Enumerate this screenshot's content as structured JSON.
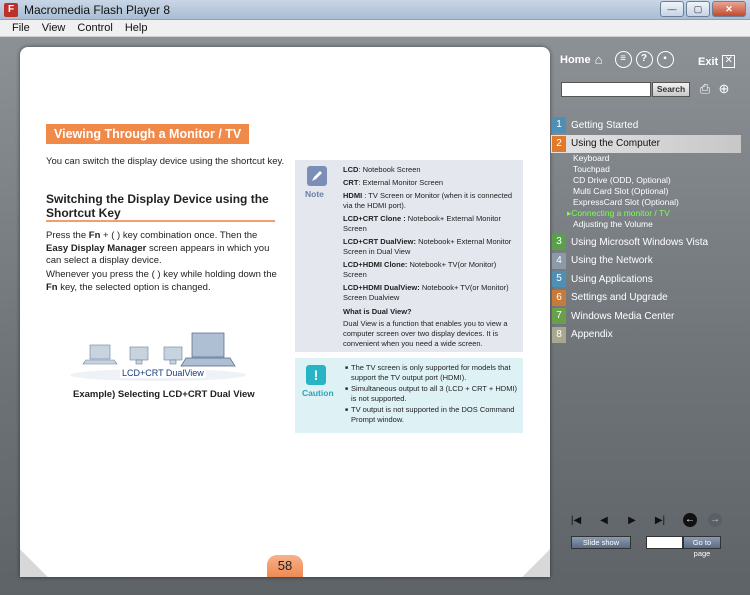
{
  "window": {
    "title": "Macromedia Flash Player 8",
    "app_icon": "F",
    "minimize": "—",
    "maximize": "▢",
    "close": "✕"
  },
  "menu": [
    "File",
    "View",
    "Control",
    "Help"
  ],
  "header": {
    "home_label": "Home",
    "exit_label": "Exit",
    "search_placeholder": "",
    "search_label": "Search"
  },
  "page": {
    "heading": "Viewing Through a Monitor / TV",
    "intro": "You can switch the display device using the shortcut key.",
    "section_title": "Switching the Display Device using the Shortcut Key",
    "para1_a": "Press the ",
    "para1_b": "Fn",
    "para1_c": " + (   ) key combination once. Then the ",
    "para1_d": "Easy Display Manager",
    "para1_e": " screen appears in which you can select a display device.",
    "para2_a": "Whenever you press the (   ) key while holding down the ",
    "para2_b": "Fn",
    "para2_c": " key, the selected option is changed.",
    "illustration_label": "LCD+CRT DualView",
    "example_caption": "Example) Selecting LCD+CRT Dual View",
    "page_number": "58"
  },
  "note": {
    "label": "Note",
    "items": [
      {
        "term": "LCD",
        "desc": ": Notebook Screen"
      },
      {
        "term": "CRT",
        "desc": ": External Monitor Screen"
      },
      {
        "term": "HDMI",
        "desc": " : TV Screen or Monitor (when it is connected via the HDMI port)."
      },
      {
        "term": "LCD+CRT Clone :",
        "desc": " Notebook+ External Monitor Screen"
      },
      {
        "term": "LCD+CRT DualView:",
        "desc": " Notebook+ External Monitor Screen in Dual View"
      },
      {
        "term": "LCD+HDMI Clone:",
        "desc": " Notebook+ TV(or Monitor) Screen"
      },
      {
        "term": "LCD+HDMI DualView:",
        "desc": " Notebook+ TV(or Monitor) Screen Dualview"
      }
    ],
    "dual_view_title": "What is Dual View?",
    "dual_view_text": "Dual View is a function that enables you to view a computer screen over two display devices. It is convenient when you need a wide screen."
  },
  "caution": {
    "label": "Caution",
    "icon": "!",
    "items": [
      "The TV screen is only supported for models that support the TV output port (HDMI).",
      "Simultaneous output to all 3 (LCD + CRT + HDMI) is not supported.",
      "TV output is not supported in the DOS Command Prompt window."
    ]
  },
  "toc": {
    "items": [
      {
        "num": "1",
        "label": "Getting Started",
        "color": "#4f8fb5"
      },
      {
        "num": "2",
        "label": "Using the Computer",
        "color": "#e07a2a"
      },
      {
        "num": "3",
        "label": "Using Microsoft Windows Vista",
        "color": "#5aa04a"
      },
      {
        "num": "4",
        "label": "Using the Network",
        "color": "#8a9aa8"
      },
      {
        "num": "5",
        "label": "Using Applications",
        "color": "#4f8fb5"
      },
      {
        "num": "6",
        "label": "Settings and Upgrade",
        "color": "#c87a3a"
      },
      {
        "num": "7",
        "label": "Windows Media Center",
        "color": "#6aa04a"
      },
      {
        "num": "8",
        "label": "Appendix",
        "color": "#a8a890"
      }
    ],
    "subitems": [
      "Keyboard",
      "Touchpad",
      "CD Drive (ODD, Optional)",
      "Multi Card Slot (Optional)",
      "ExpressCard Slot (Optional)",
      "▸Connecting a monitor / TV",
      "Adjusting the Volume"
    ],
    "current_subitem": 5
  },
  "footer": {
    "slide_show": "Slide show",
    "goto_page": "Go to page",
    "goto_value": ""
  }
}
